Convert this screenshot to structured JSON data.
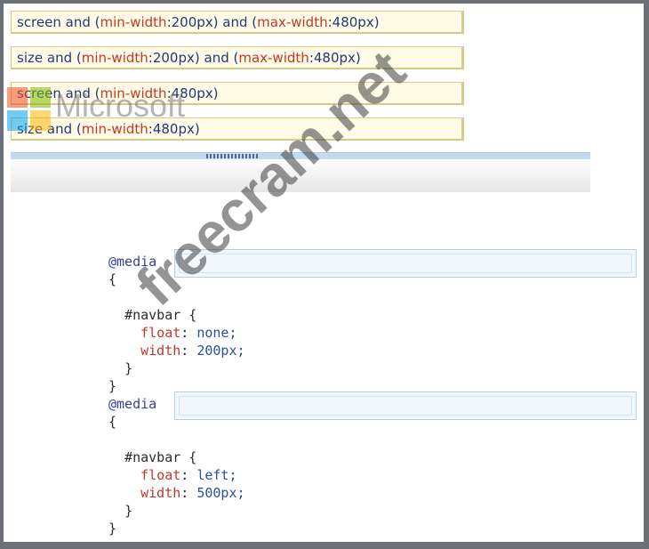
{
  "options": [
    {
      "type": "screen",
      "and1": "and",
      "p1": "min-width",
      "v1": ":200px",
      "and2": "and",
      "p2": "max-width",
      "v2": ":480px"
    },
    {
      "type": "size",
      "and1": "and",
      "p1": "min-width",
      "v1": ":200px",
      "and2": "and",
      "p2": "max-width",
      "v2": ":480px"
    },
    {
      "type": "screen",
      "and1": "and",
      "p1": "min-width",
      "v1": ":480px"
    },
    {
      "type": "size",
      "and1": "and",
      "p1": "min-width",
      "v1": ":480px"
    }
  ],
  "code": {
    "media1": "@media",
    "open1": "{",
    "selector1": "#navbar {",
    "rule1a_prop": "float",
    "rule1a_val": "none;",
    "rule1b_prop": "width",
    "rule1b_val": "200px;",
    "close_inner1": "}",
    "close1": "}",
    "media2": "@media",
    "open2": "{",
    "selector2": "#navbar {",
    "rule2a_prop": "float",
    "rule2a_val": "left;",
    "rule2b_prop": "width",
    "rule2b_val": "500px;",
    "close_inner2": "}",
    "close2": "}"
  },
  "overlay": {
    "logo_text": "Microsoft",
    "watermark": "freecram.net"
  },
  "colors": {
    "option_bg": "#fffbe6",
    "property": "#c0392b",
    "keyword": "#3b3b9c",
    "slot_bg": "#f3f8fe"
  }
}
